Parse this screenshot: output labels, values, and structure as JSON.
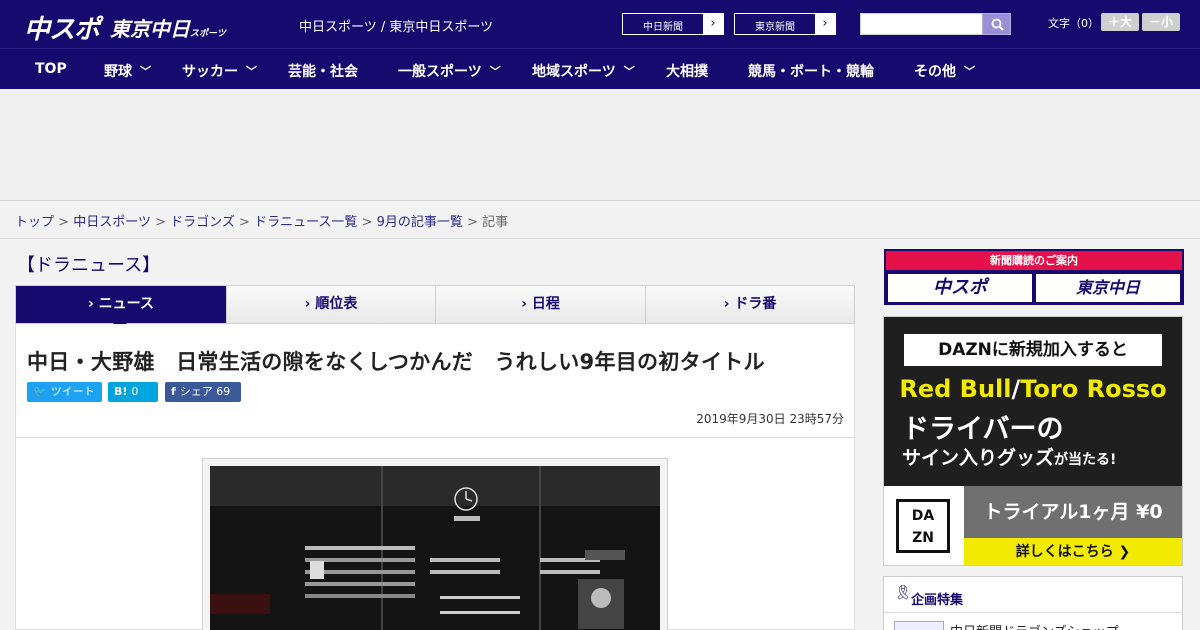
{
  "header": {
    "logo_chuspo": "中スポ",
    "logo_tokyo": "東京中日",
    "logo_tokyo_small": "スポーツ",
    "site_title": "中日スポーツ / 東京中日スポーツ",
    "ext_links": [
      "中日新聞",
      "東京新聞"
    ],
    "search": {
      "placeholder": ""
    },
    "fontsize_label": "文字（0）",
    "fontsize_up": "＋大",
    "fontsize_down": "－小"
  },
  "nav": {
    "items": [
      {
        "label": "TOP",
        "has_menu": false
      },
      {
        "label": "野球",
        "has_menu": true
      },
      {
        "label": "サッカー",
        "has_menu": true
      },
      {
        "label": "芸能・社会",
        "has_menu": false
      },
      {
        "label": "一般スポーツ",
        "has_menu": true
      },
      {
        "label": "地域スポーツ",
        "has_menu": true
      },
      {
        "label": "大相撲",
        "has_menu": false
      },
      {
        "label": "競馬・ボート・競輪",
        "has_menu": false
      },
      {
        "label": "その他",
        "has_menu": true
      }
    ]
  },
  "breadcrumb": {
    "items": [
      "トップ",
      "中日スポーツ",
      "ドラゴンズ",
      "ドラニュース一覧",
      "9月の記事一覧"
    ],
    "current": "記事",
    "separator": ">"
  },
  "main": {
    "section_title": "【ドラニュース】",
    "tabs": [
      {
        "label": "ニュース",
        "active": true
      },
      {
        "label": "順位表",
        "active": false
      },
      {
        "label": "日程",
        "active": false
      },
      {
        "label": "ドラ番",
        "active": false
      }
    ],
    "headline": "中日・大野雄　日常生活の隙をなくしつかんだ　うれしい9年目の初タイトル",
    "share": {
      "tweet_label": "ツイート",
      "hatena_count": "0",
      "facebook_label": "シェア",
      "facebook_count": "69"
    },
    "pubdate": "2019年9月30日 23時57分"
  },
  "sidebar": {
    "subscribe_head": "新聞購読のご案内",
    "subscribe_logos": [
      "中スポ",
      "東京中日"
    ],
    "dazn": {
      "top_text": "DAZNに新規加入すると",
      "rb_left": "Red Bull",
      "rb_sep": "/",
      "rb_right": "Toro Rosso",
      "driver": "ドライバーの",
      "sign_main": "サイン入りグッズ",
      "sign_small": "が当たる!",
      "logo_top": "DA",
      "logo_bottom": "ZN",
      "trial": "トライアル1ヶ月 ¥0",
      "cta": "詳しくはこちら ❯"
    },
    "feature_title": "企画特集",
    "feature_item": "中日新聞ドラゴンズショップ"
  },
  "colors": {
    "brand_navy": "#170a6e",
    "twitter": "#1da1f2",
    "hatena": "#00a4de",
    "facebook": "#3b5998",
    "dazn_yellow": "#f2ea00",
    "subscribe_red": "#e5104a"
  }
}
